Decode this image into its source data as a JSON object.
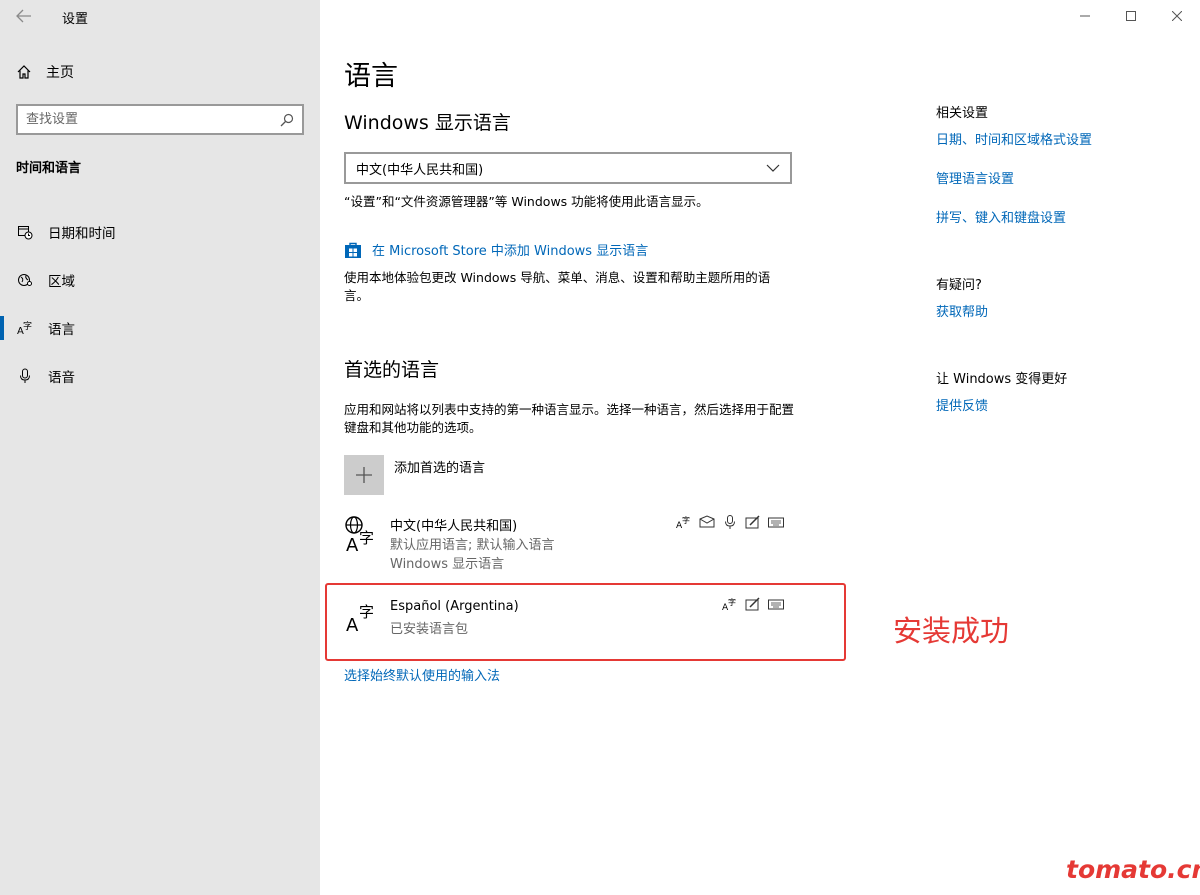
{
  "window": {
    "title": "设置",
    "controls": {
      "minimize": "minimize",
      "maximize": "maximize",
      "close": "close"
    }
  },
  "sidebar": {
    "home_label": "主页",
    "search_placeholder": "查找设置",
    "section_title": "时间和语言",
    "items": [
      {
        "label": "日期和时间",
        "icon": "calendar-clock-icon",
        "active": false
      },
      {
        "label": "区域",
        "icon": "globe-region-icon",
        "active": false
      },
      {
        "label": "语言",
        "icon": "language-icon",
        "active": true
      },
      {
        "label": "语音",
        "icon": "microphone-icon",
        "active": false
      }
    ]
  },
  "main": {
    "title": "语言",
    "display_language": {
      "heading": "Windows 显示语言",
      "selected": "中文(中华人民共和国)",
      "description": "“设置”和“文件资源管理器”等 Windows 功能将使用此语言显示。",
      "store_link": "在 Microsoft Store 中添加 Windows 显示语言",
      "store_description": "使用本地体验包更改 Windows 导航、菜单、消息、设置和帮助主题所用的语言。"
    },
    "preferred": {
      "heading": "首选的语言",
      "description": "应用和网站将以列表中支持的第一种语言显示。选择一种语言，然后选择用于配置键盘和其他功能的选项。",
      "add_label": "添加首选的语言",
      "languages": [
        {
          "name": "中文(中华人民共和国)",
          "line1": "默认应用语言; 默认输入语言",
          "line2": "Windows 显示语言"
        },
        {
          "name": "Español (Argentina)",
          "line1": "已安装语言包"
        }
      ],
      "input_method_link": "选择始终默认使用的输入法"
    }
  },
  "annotation": {
    "success_text": "安装成功",
    "highlight_color": "#e53935"
  },
  "related": {
    "heading": "相关设置",
    "links": [
      "日期、时间和区域格式设置",
      "管理语言设置",
      "拼写、键入和键盘设置"
    ],
    "question_heading": "有疑问?",
    "help_link": "获取帮助",
    "improve_heading": "让 Windows 变得更好",
    "feedback_link": "提供反馈"
  },
  "watermark": "tomato.cm",
  "colors": {
    "accent": "#0067b8",
    "sidebar_bg": "#e6e6e6",
    "red": "#e53935"
  }
}
